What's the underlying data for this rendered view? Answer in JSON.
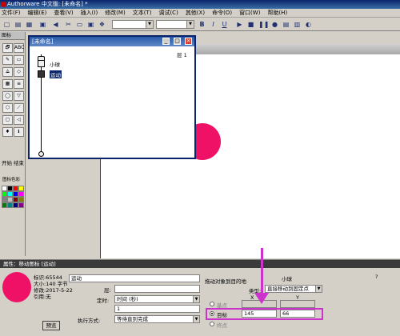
{
  "app": {
    "title": "Authorware 中文版: [未命名] *"
  },
  "menu": [
    "文件(F)",
    "编辑(E)",
    "查看(V)",
    "插入(I)",
    "修改(M)",
    "文本(T)",
    "调试(C)",
    "其他(X)",
    "命令(O)",
    "窗口(W)",
    "帮助(H)"
  ],
  "toolbar": {
    "glyphs": [
      "▢",
      "▤",
      "▦",
      "▣",
      "◀",
      "✂",
      "▭",
      "▣",
      "❖"
    ],
    "format": {
      "bold": "B",
      "italic": "I",
      "underline": "U"
    },
    "play_glyphs": [
      "▶",
      "■",
      "❚❚",
      "●",
      "▤",
      "▥",
      "◐"
    ]
  },
  "icon_panel": {
    "title": "图标",
    "icons": [
      "🗗",
      "ABC",
      "✎",
      "▭",
      "⟁",
      "◇",
      "▦",
      "≡",
      "◯",
      "▽",
      "⬡",
      "⟋",
      "▢",
      "◁",
      "♦",
      "ℹ"
    ],
    "start_label": "开始",
    "end_label": "结束",
    "color_label": "图标色彩",
    "colors": [
      "#ffffff",
      "#000000",
      "#ff0000",
      "#ffff00",
      "#00ff00",
      "#00ffff",
      "#0000ff",
      "#ff00ff",
      "#808080",
      "#c0c0c0",
      "#800000",
      "#808000",
      "#008000",
      "#008080",
      "#000080",
      "#800080"
    ]
  },
  "flow_window": {
    "title": "[未命名]",
    "layer_label": "层 1",
    "nodes": [
      {
        "label": "小球"
      },
      {
        "label": "运动"
      }
    ]
  },
  "stage": {
    "circle_color": "#ee1166"
  },
  "properties": {
    "header": "属性：移动图标 [运动]",
    "info": {
      "id_label": "标识:",
      "id": "65544",
      "size_label": "大小:",
      "size": "140 字节",
      "date_label": "修改:",
      "date": "2017-5-22",
      "ref_label": "引用:",
      "ref": "无"
    },
    "preview_label": "预览",
    "name_value": "运动",
    "layer_label": "层:",
    "timing_label": "定时:",
    "timing_value": "时间 (秒)",
    "duration_value": "1",
    "exec_label": "执行方式:",
    "exec_value": "等待直到完成",
    "drag_label": "拖动对象到目的地",
    "object_value": "小球",
    "type_label": "类型:",
    "type_value": "直接移动到固定点",
    "col_x": "X",
    "col_y": "Y",
    "base_label": "基点",
    "target_label": "目标",
    "end_label": "终点",
    "target_x": "145",
    "target_y": "66",
    "help": "?"
  }
}
